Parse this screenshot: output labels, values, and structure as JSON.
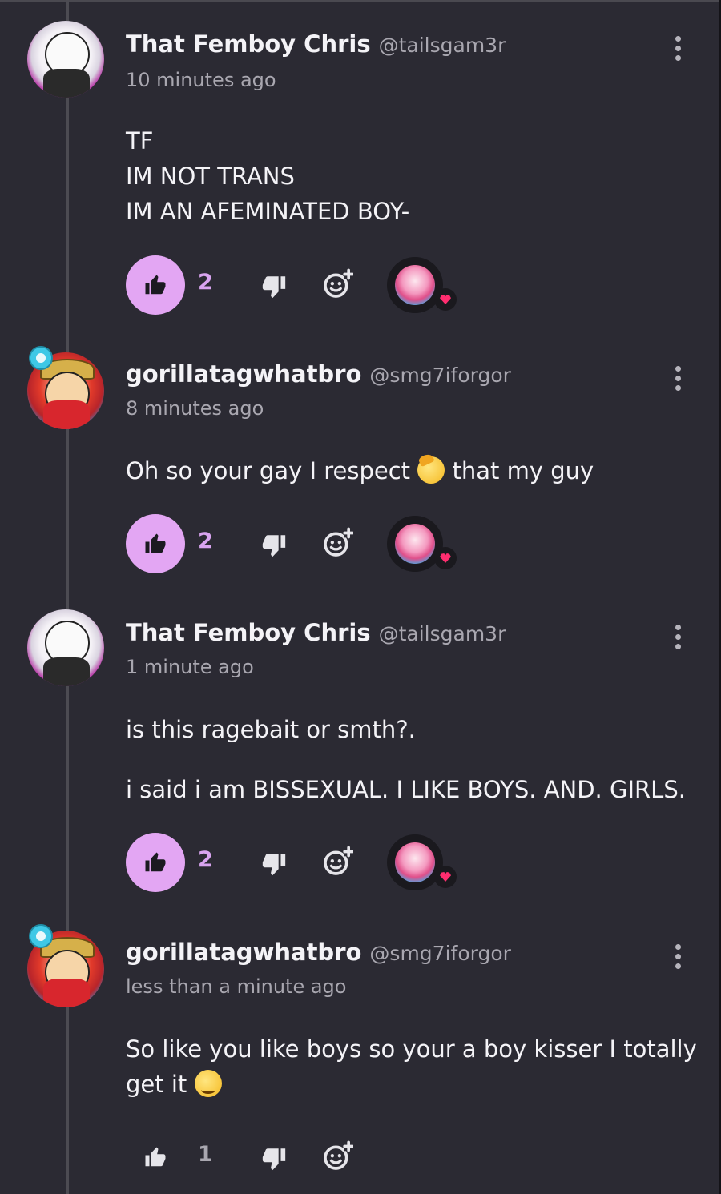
{
  "comments": [
    {
      "author": "That Femboy Chris",
      "handle": "@tailsgam3r",
      "time": "10 minutes ago",
      "lines": [
        "TF",
        "IM NOT TRANS",
        "IM AN AFEMINATED BOY-"
      ],
      "likes": "2",
      "liked": true,
      "has_reaction": true
    },
    {
      "author": "gorillatagwhatbro",
      "handle": "@smg7iforgor",
      "time": "8 minutes ago",
      "lines": [
        "Oh so your gay I respect",
        "that my guy"
      ],
      "emoji": "saluting-face-emoji",
      "likes": "2",
      "liked": true,
      "has_reaction": true
    },
    {
      "author": "That Femboy Chris",
      "handle": "@tailsgam3r",
      "time": "1 minute ago",
      "lines": [
        "is this ragebait or smth?.",
        "i said i am BISSEXUAL. I LIKE BOYS. AND. GIRLS."
      ],
      "likes": "2",
      "liked": true,
      "has_reaction": true
    },
    {
      "author": "gorillatagwhatbro",
      "handle": "@smg7iforgor",
      "time": "less than a minute ago",
      "lines": [
        "So like you like boys so your a boy kisser I totally",
        "get it"
      ],
      "emoji": "smiling-face-emoji",
      "likes": "1",
      "liked": false,
      "has_reaction": false
    }
  ],
  "colors": {
    "background": "#2b2a33",
    "like_active": "#e3a6f3",
    "heart": "#ff2d6f"
  },
  "icons": [
    "thumbs-up-icon",
    "thumbs-down-icon",
    "add-reaction-icon",
    "more-options-icon",
    "heart-icon"
  ]
}
